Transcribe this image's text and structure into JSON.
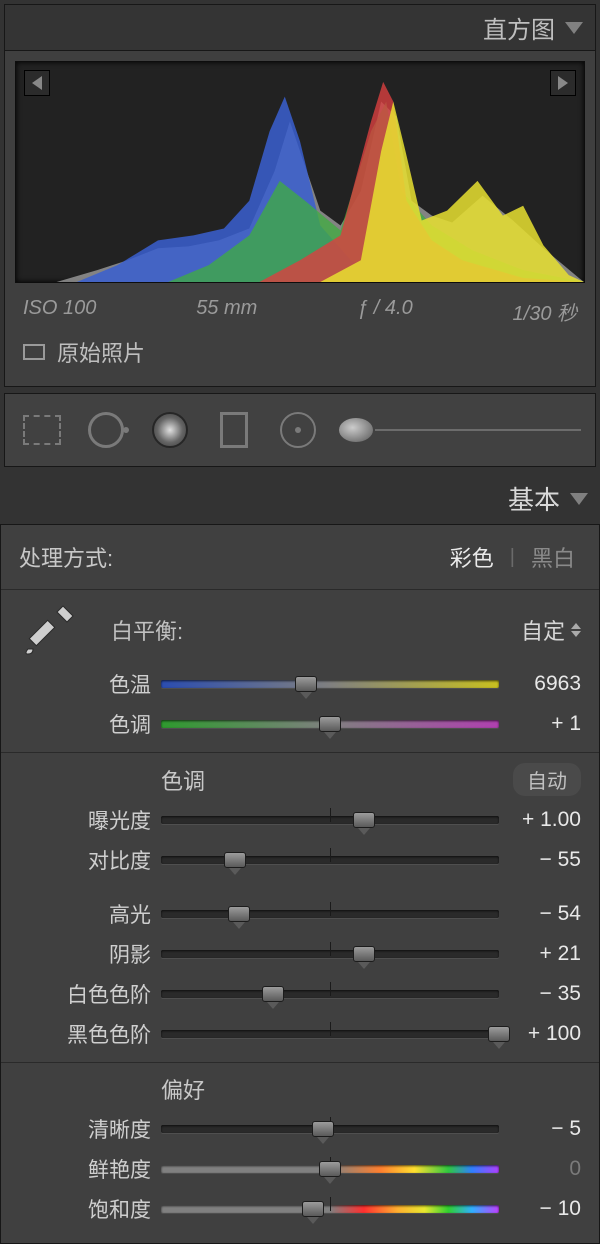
{
  "histogram": {
    "title": "直方图",
    "exif": {
      "iso": "ISO 100",
      "focal": "55 mm",
      "aperture": "ƒ / 4.0",
      "shutter": "1/30 秒"
    },
    "original_label": "原始照片"
  },
  "tools": {
    "crop": "crop",
    "spot": "spot-removal",
    "radial": "radial-filter",
    "rect": "graduated-filter",
    "target": "redeye",
    "brush": "adjustment-brush"
  },
  "basic": {
    "title": "基本",
    "treatment": {
      "label": "处理方式:",
      "color": "彩色",
      "bw": "黑白",
      "active": "color"
    },
    "wb": {
      "label": "白平衡:",
      "preset": "自定"
    },
    "temp": {
      "label": "色温",
      "value": "6963",
      "pos": 43
    },
    "tint": {
      "label": "色调",
      "value": "+ 1",
      "pos": 50
    },
    "tone_header": "色调",
    "auto_label": "自动",
    "exposure": {
      "label": "曝光度",
      "value": "+ 1.00",
      "pos": 60
    },
    "contrast": {
      "label": "对比度",
      "value": "− 55",
      "pos": 22
    },
    "highlights": {
      "label": "高光",
      "value": "− 54",
      "pos": 23
    },
    "shadows": {
      "label": "阴影",
      "value": "+ 21",
      "pos": 60
    },
    "whites": {
      "label": "白色色阶",
      "value": "− 35",
      "pos": 33
    },
    "blacks": {
      "label": "黑色色阶",
      "value": "+ 100",
      "pos": 100
    },
    "presence_header": "偏好",
    "clarity": {
      "label": "清晰度",
      "value": "− 5",
      "pos": 48
    },
    "vibrance": {
      "label": "鲜艳度",
      "value": "0",
      "pos": 50,
      "dim": true
    },
    "saturation": {
      "label": "饱和度",
      "value": "− 10",
      "pos": 45
    }
  }
}
